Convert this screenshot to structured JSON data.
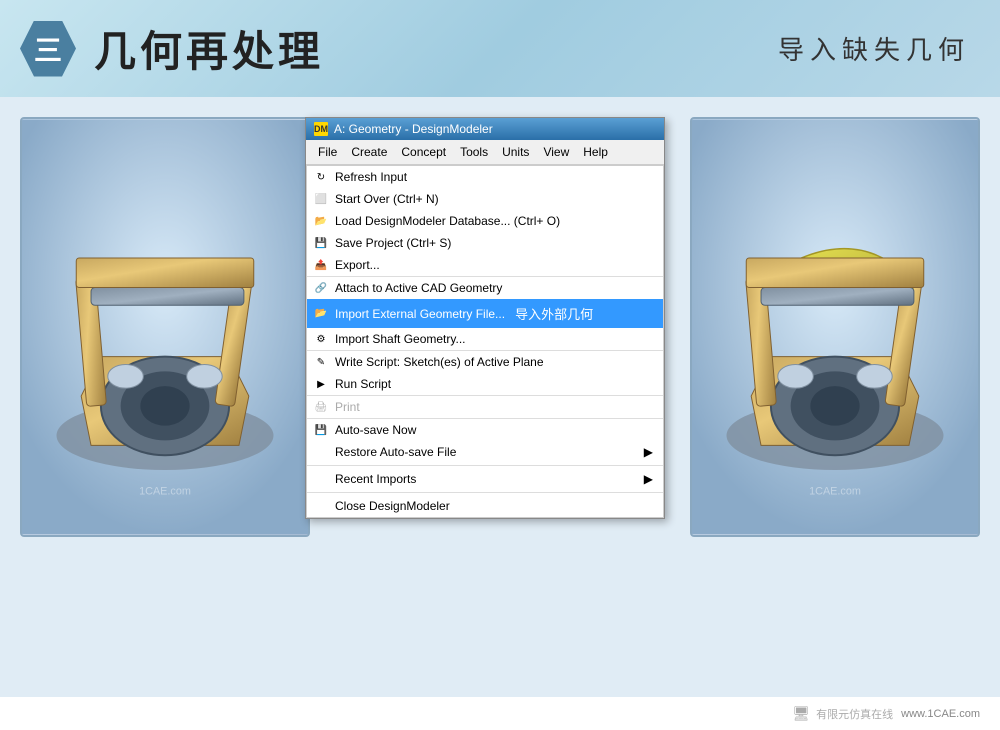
{
  "header": {
    "step_number": "三",
    "title": "几何再处理",
    "subtitle": "导入缺失几何"
  },
  "titlebar": {
    "title": "A: Geometry - DesignModeler",
    "icon": "DM"
  },
  "menubar": {
    "items": [
      "File",
      "Create",
      "Concept",
      "Tools",
      "Units",
      "View",
      "Help"
    ]
  },
  "menu": {
    "items": [
      {
        "id": "refresh-input",
        "label": "Refresh Input",
        "shortcut": "",
        "icon": "↻",
        "has_arrow": false,
        "disabled": false,
        "highlighted": false,
        "separator_after": false
      },
      {
        "id": "start-over",
        "label": "Start Over (Ctrl+ N)",
        "shortcut": "",
        "icon": "◻",
        "has_arrow": false,
        "disabled": false,
        "highlighted": false,
        "separator_after": false
      },
      {
        "id": "load-db",
        "label": "Load DesignModeler Database... (Ctrl+ O)",
        "shortcut": "",
        "icon": "📁",
        "has_arrow": false,
        "disabled": false,
        "highlighted": false,
        "separator_after": false
      },
      {
        "id": "save-project",
        "label": "Save Project (Ctrl+ S)",
        "shortcut": "",
        "icon": "💾",
        "has_arrow": false,
        "disabled": false,
        "highlighted": false,
        "separator_after": false
      },
      {
        "id": "export",
        "label": "Export...",
        "shortcut": "",
        "icon": "📤",
        "has_arrow": false,
        "disabled": false,
        "highlighted": false,
        "separator_after": true
      },
      {
        "id": "attach-cad",
        "label": "Attach to Active CAD Geometry",
        "shortcut": "",
        "icon": "🔗",
        "has_arrow": false,
        "disabled": false,
        "highlighted": false,
        "separator_after": false
      },
      {
        "id": "import-external",
        "label": "Import External Geometry File...",
        "shortcut": "",
        "icon": "📂",
        "has_arrow": false,
        "disabled": false,
        "highlighted": true,
        "separator_after": false,
        "overlay_label": "导入外部几何"
      },
      {
        "id": "import-shaft",
        "label": "Import Shaft Geometry...",
        "shortcut": "",
        "icon": "⚙",
        "has_arrow": false,
        "disabled": false,
        "highlighted": false,
        "separator_after": true
      },
      {
        "id": "write-script",
        "label": "Write Script: Sketch(es) of Active Plane",
        "shortcut": "",
        "icon": "✎",
        "has_arrow": false,
        "disabled": false,
        "highlighted": false,
        "separator_after": false
      },
      {
        "id": "run-script",
        "label": "Run Script",
        "shortcut": "",
        "icon": "▶",
        "has_arrow": false,
        "disabled": false,
        "highlighted": false,
        "separator_after": true
      },
      {
        "id": "print",
        "label": "Print",
        "shortcut": "",
        "icon": "🖨",
        "has_arrow": false,
        "disabled": true,
        "highlighted": false,
        "separator_after": true
      },
      {
        "id": "auto-save",
        "label": "Auto-save Now",
        "shortcut": "",
        "icon": "💾",
        "has_arrow": false,
        "disabled": false,
        "highlighted": false,
        "separator_after": false
      },
      {
        "id": "restore-auto",
        "label": "Restore Auto-save File",
        "shortcut": "",
        "icon": "",
        "has_arrow": true,
        "disabled": false,
        "highlighted": false,
        "separator_after": false
      },
      {
        "id": "separator2",
        "label": "",
        "separator": true
      },
      {
        "id": "recent-imports",
        "label": "Recent Imports",
        "shortcut": "",
        "icon": "",
        "has_arrow": true,
        "disabled": false,
        "highlighted": false,
        "separator_after": false
      },
      {
        "id": "separator3",
        "label": "",
        "separator": true
      },
      {
        "id": "close-dm",
        "label": "Close DesignModeler",
        "shortcut": "",
        "icon": "",
        "has_arrow": false,
        "disabled": false,
        "highlighted": false,
        "separator_after": false
      }
    ]
  },
  "footer": {
    "watermark1": "有限元仿真在线",
    "watermark2": "www.1CAE.com"
  },
  "colors": {
    "header_bg": "#b8d8e8",
    "menu_highlight": "#3399ff",
    "titlebar_bg": "#2a6fa8"
  }
}
